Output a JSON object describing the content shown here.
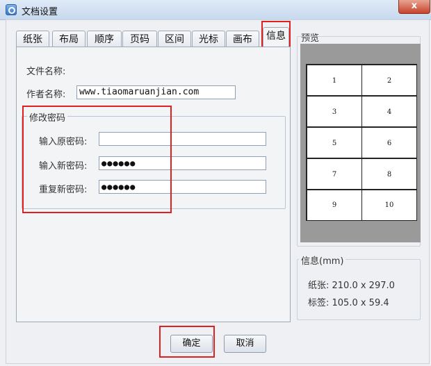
{
  "window": {
    "title": "文档设置",
    "close_label": "x"
  },
  "tabs": [
    {
      "label": "纸张"
    },
    {
      "label": "布局"
    },
    {
      "label": "顺序"
    },
    {
      "label": "页码"
    },
    {
      "label": "区间"
    },
    {
      "label": "光标"
    },
    {
      "label": "画布"
    },
    {
      "label": "信息"
    }
  ],
  "active_tab": "信息",
  "info": {
    "file_name_label": "文件名称:",
    "author_label": "作者名称:",
    "author_value": "www.tiaomaruanjian.com"
  },
  "password_group": {
    "title": "修改密码",
    "old_label": "输入原密码:",
    "old_value": "",
    "new_label": "输入新密码:",
    "new_value": "●●●●●●",
    "repeat_label": "重复新密码:",
    "repeat_value": "●●●●●●"
  },
  "preview": {
    "title": "预览",
    "cells": [
      "1",
      "2",
      "3",
      "4",
      "5",
      "6",
      "7",
      "8",
      "9",
      "10"
    ]
  },
  "info_group": {
    "title": "信息(mm)",
    "paper": "纸张:  210.0 x 297.0",
    "label": "标签:  105.0 x 59.4"
  },
  "buttons": {
    "ok": "确定",
    "cancel": "取消"
  },
  "colors": {
    "highlight": "#e02020",
    "preview_bg": "#9a9a9a"
  }
}
